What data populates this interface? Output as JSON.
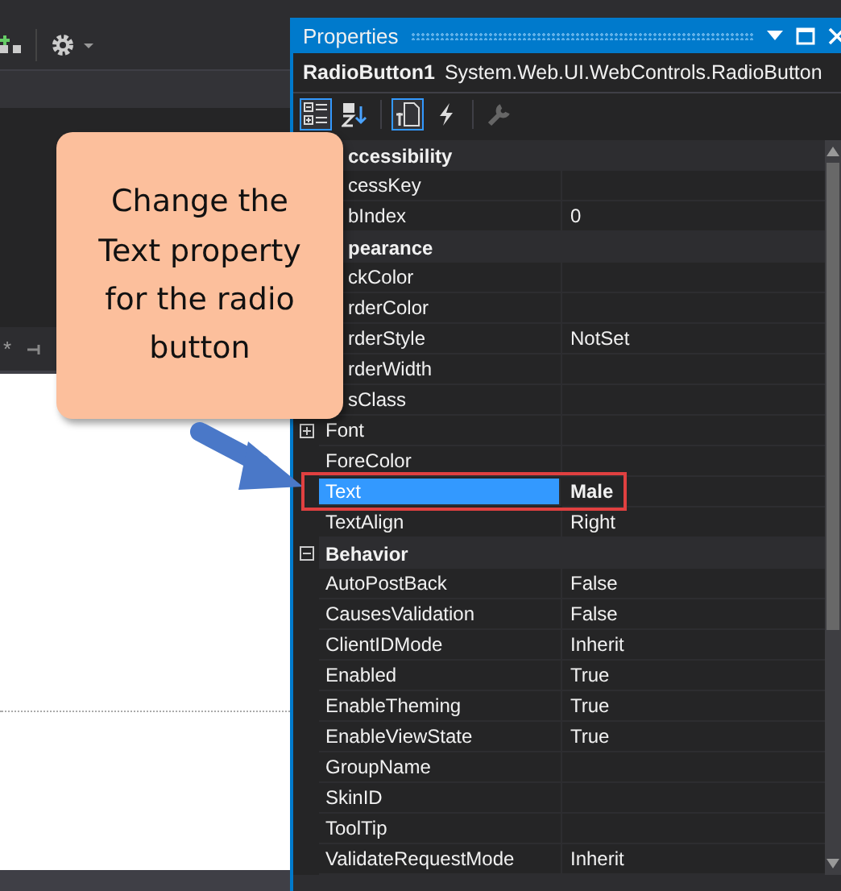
{
  "ide": {
    "tab_marker": "*"
  },
  "properties": {
    "title": "Properties",
    "object_name": "RadioButton1",
    "object_type": "System.Web.UI.WebControls.RadioButton",
    "toolbar": [
      {
        "kind": "categorized",
        "selected": true
      },
      {
        "kind": "alphabetical",
        "selected": false
      },
      {
        "kind": "properties",
        "selected": true
      },
      {
        "kind": "events",
        "selected": false
      },
      {
        "kind": "pages",
        "selected": false
      }
    ],
    "groups": [
      {
        "name": "ccessibility",
        "covered": true,
        "rows": [
          {
            "name": "cessKey",
            "value": "",
            "covered": true,
            "selected": false
          },
          {
            "name": "bIndex",
            "value": "0",
            "covered": true,
            "selected": false,
            "modified": false
          }
        ]
      },
      {
        "name": "pearance",
        "covered": true,
        "rows": [
          {
            "name": "ckColor",
            "value": "",
            "covered": true,
            "selected": false
          },
          {
            "name": "rderColor",
            "value": "",
            "covered": true,
            "selected": false
          },
          {
            "name": "rderStyle",
            "value": "NotSet",
            "covered": true,
            "selected": false,
            "modified": false
          },
          {
            "name": "rderWidth",
            "value": "",
            "covered": true,
            "selected": false
          },
          {
            "name": "sClass",
            "value": "",
            "covered": true,
            "selected": false
          },
          {
            "name": "Font",
            "value": "",
            "selected": false,
            "expandable": true
          },
          {
            "name": "ForeColor",
            "value": "",
            "selected": false
          },
          {
            "name": "Text",
            "value": "Male",
            "selected": true,
            "modified": true
          },
          {
            "name": "TextAlign",
            "value": "Right",
            "selected": false,
            "modified": false
          }
        ]
      },
      {
        "name": "Behavior",
        "expanded": true,
        "rows": [
          {
            "name": "AutoPostBack",
            "value": "False",
            "selected": false,
            "modified": false
          },
          {
            "name": "CausesValidation",
            "value": "False",
            "selected": false,
            "modified": false
          },
          {
            "name": "ClientIDMode",
            "value": "Inherit",
            "selected": false,
            "modified": false
          },
          {
            "name": "Enabled",
            "value": "True",
            "selected": false,
            "modified": false
          },
          {
            "name": "EnableTheming",
            "value": "True",
            "selected": false,
            "modified": false
          },
          {
            "name": "EnableViewState",
            "value": "True",
            "selected": false,
            "modified": false
          },
          {
            "name": "GroupName",
            "value": "",
            "selected": false
          },
          {
            "name": "SkinID",
            "value": "",
            "selected": false
          },
          {
            "name": "ToolTip",
            "value": "",
            "selected": false
          },
          {
            "name": "ValidateRequestMode",
            "value": "Inherit",
            "selected": false,
            "modified": false
          }
        ]
      }
    ]
  },
  "callout": {
    "text": "Change the Text property for the radio button"
  }
}
